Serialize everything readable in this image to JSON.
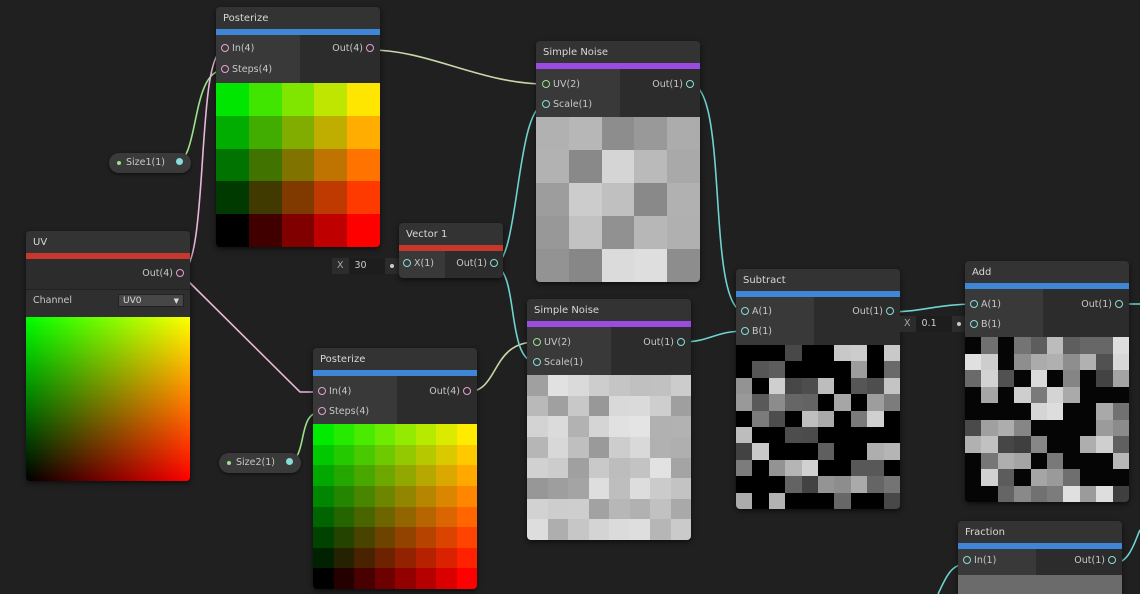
{
  "colors": {
    "background": "#202020",
    "node_body": "#2f2f2f",
    "bar_blue": "#3f86d6",
    "bar_red": "#c6382b",
    "bar_purple": "#9a4ce0",
    "wire_cyan": "#6fd3cf",
    "wire_pink": "#e9b6d9",
    "wire_green": "#9be38a"
  },
  "nodes": {
    "posterize_top": {
      "title": "Posterize",
      "in": "In(4)",
      "steps": "Steps(4)",
      "out": "Out(4)"
    },
    "uv": {
      "title": "UV",
      "out": "Out(4)",
      "channel_label": "Channel",
      "channel_value": "UV0"
    },
    "vector1": {
      "title": "Vector 1",
      "in": "X(1)",
      "out": "Out(1)"
    },
    "noise_top": {
      "title": "Simple Noise",
      "uv": "UV(2)",
      "scale": "Scale(1)",
      "out": "Out(1)"
    },
    "noise_bottom": {
      "title": "Simple Noise",
      "uv": "UV(2)",
      "scale": "Scale(1)",
      "out": "Out(1)"
    },
    "posterize_bottom": {
      "title": "Posterize",
      "in": "In(4)",
      "steps": "Steps(4)",
      "out": "Out(4)"
    },
    "subtract": {
      "title": "Subtract",
      "a": "A(1)",
      "b": "B(1)",
      "out": "Out(1)"
    },
    "add": {
      "title": "Add",
      "a": "A(1)",
      "b": "B(1)",
      "out": "Out(1)"
    },
    "fraction": {
      "title": "Fraction",
      "in": "In(1)",
      "out": "Out(1)"
    }
  },
  "properties": {
    "size1": "Size1(1)",
    "size2": "Size2(1)"
  },
  "inline_inputs": {
    "vector_x": {
      "label": "X",
      "value": "30"
    },
    "add_b": {
      "label": "X",
      "value": "0.1"
    }
  },
  "icons": [
    "port-dot",
    "dropdown-arrow-icon"
  ]
}
